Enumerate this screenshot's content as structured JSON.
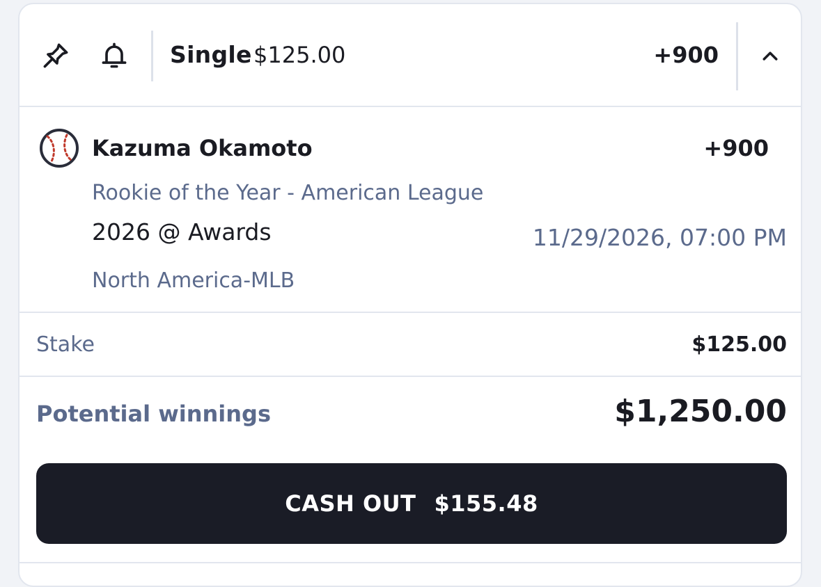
{
  "header": {
    "bet_type": "Single",
    "bet_amount": "$125.00",
    "odds": "+900",
    "icons": [
      "pin-icon",
      "bell-icon",
      "chevron-up-icon"
    ]
  },
  "selection": {
    "name": "Kazuma Okamoto",
    "odds": "+900",
    "sport_icon": "baseball-icon",
    "market": "Rookie of the Year - American League",
    "event": "2026 @ Awards",
    "date": "11/29/2026, 07:00 PM",
    "league": "North America-MLB"
  },
  "stake": {
    "label": "Stake",
    "value": "$125.00"
  },
  "winnings": {
    "label": "Potential winnings",
    "value": "$1,250.00"
  },
  "cashout": {
    "label": "CASH OUT",
    "amount": "$155.48"
  },
  "colors": {
    "text_primary": "#1a1b22",
    "text_muted": "#5b6a8c",
    "divider": "#e2e6ee",
    "button_bg": "#1a1c26",
    "ball_stitch": "#c0392b"
  }
}
